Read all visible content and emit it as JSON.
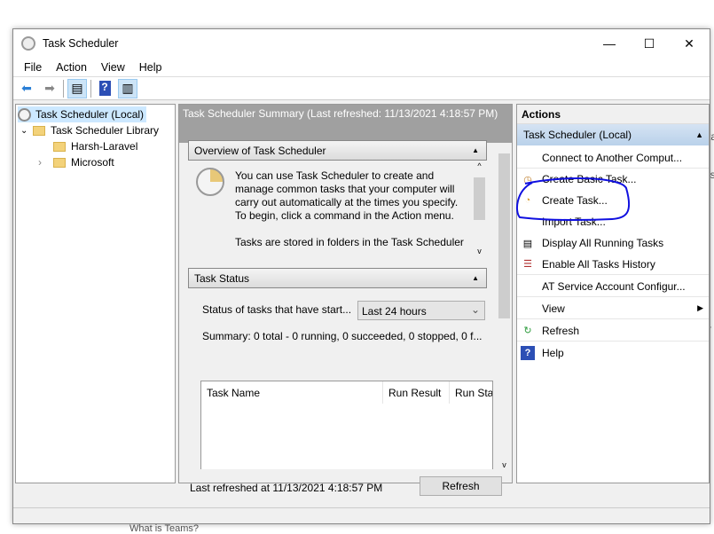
{
  "background": {
    "bottom_text": "What is Teams?",
    "right_fragments": [
      "ta",
      "is",
      "r"
    ]
  },
  "window": {
    "title": "Task Scheduler",
    "controls": {
      "minimize": "—",
      "maximize": "☐",
      "close": "✕"
    }
  },
  "menu": [
    "File",
    "Action",
    "View",
    "Help"
  ],
  "toolbar": {
    "icons": [
      "back-arrow-icon",
      "forward-arrow-icon",
      "show-hide-console-tree-icon",
      "help-icon",
      "show-hide-action-pane-icon"
    ]
  },
  "tree": {
    "root": "Task Scheduler (Local)",
    "library": "Task Scheduler Library",
    "children": [
      "Harsh-Laravel",
      "Microsoft"
    ]
  },
  "summary": {
    "header": "Task Scheduler Summary (Last refreshed: 11/13/2021 4:18:57 PM)",
    "overview_title": "Overview of Task Scheduler",
    "overview_text": "You can use Task Scheduler to create and manage common tasks that your computer will carry out automatically at the times you specify. To begin, click a command in the Action menu.",
    "overview_text2": "Tasks are stored in folders in the Task Scheduler",
    "status_title": "Task Status",
    "status_label": "Status of tasks that have start...",
    "status_select": "Last 24 hours",
    "summary_line": "Summary: 0 total - 0 running, 0 succeeded, 0 stopped, 0 f...",
    "columns": [
      "Task Name",
      "Run Result",
      "Run Sta"
    ],
    "last_refreshed": "Last refreshed at 11/13/2021 4:18:57 PM",
    "refresh_button": "Refresh"
  },
  "actions": {
    "title": "Actions",
    "group": "Task Scheduler (Local)",
    "items": [
      "Connect to Another Comput...",
      "Create Basic Task...",
      "Create Task...",
      "Import Task...",
      "Display All Running Tasks",
      "Enable All Tasks History",
      "AT Service Account Configur...",
      "View",
      "Refresh",
      "Help"
    ]
  },
  "annotation_color": "#1010e0"
}
